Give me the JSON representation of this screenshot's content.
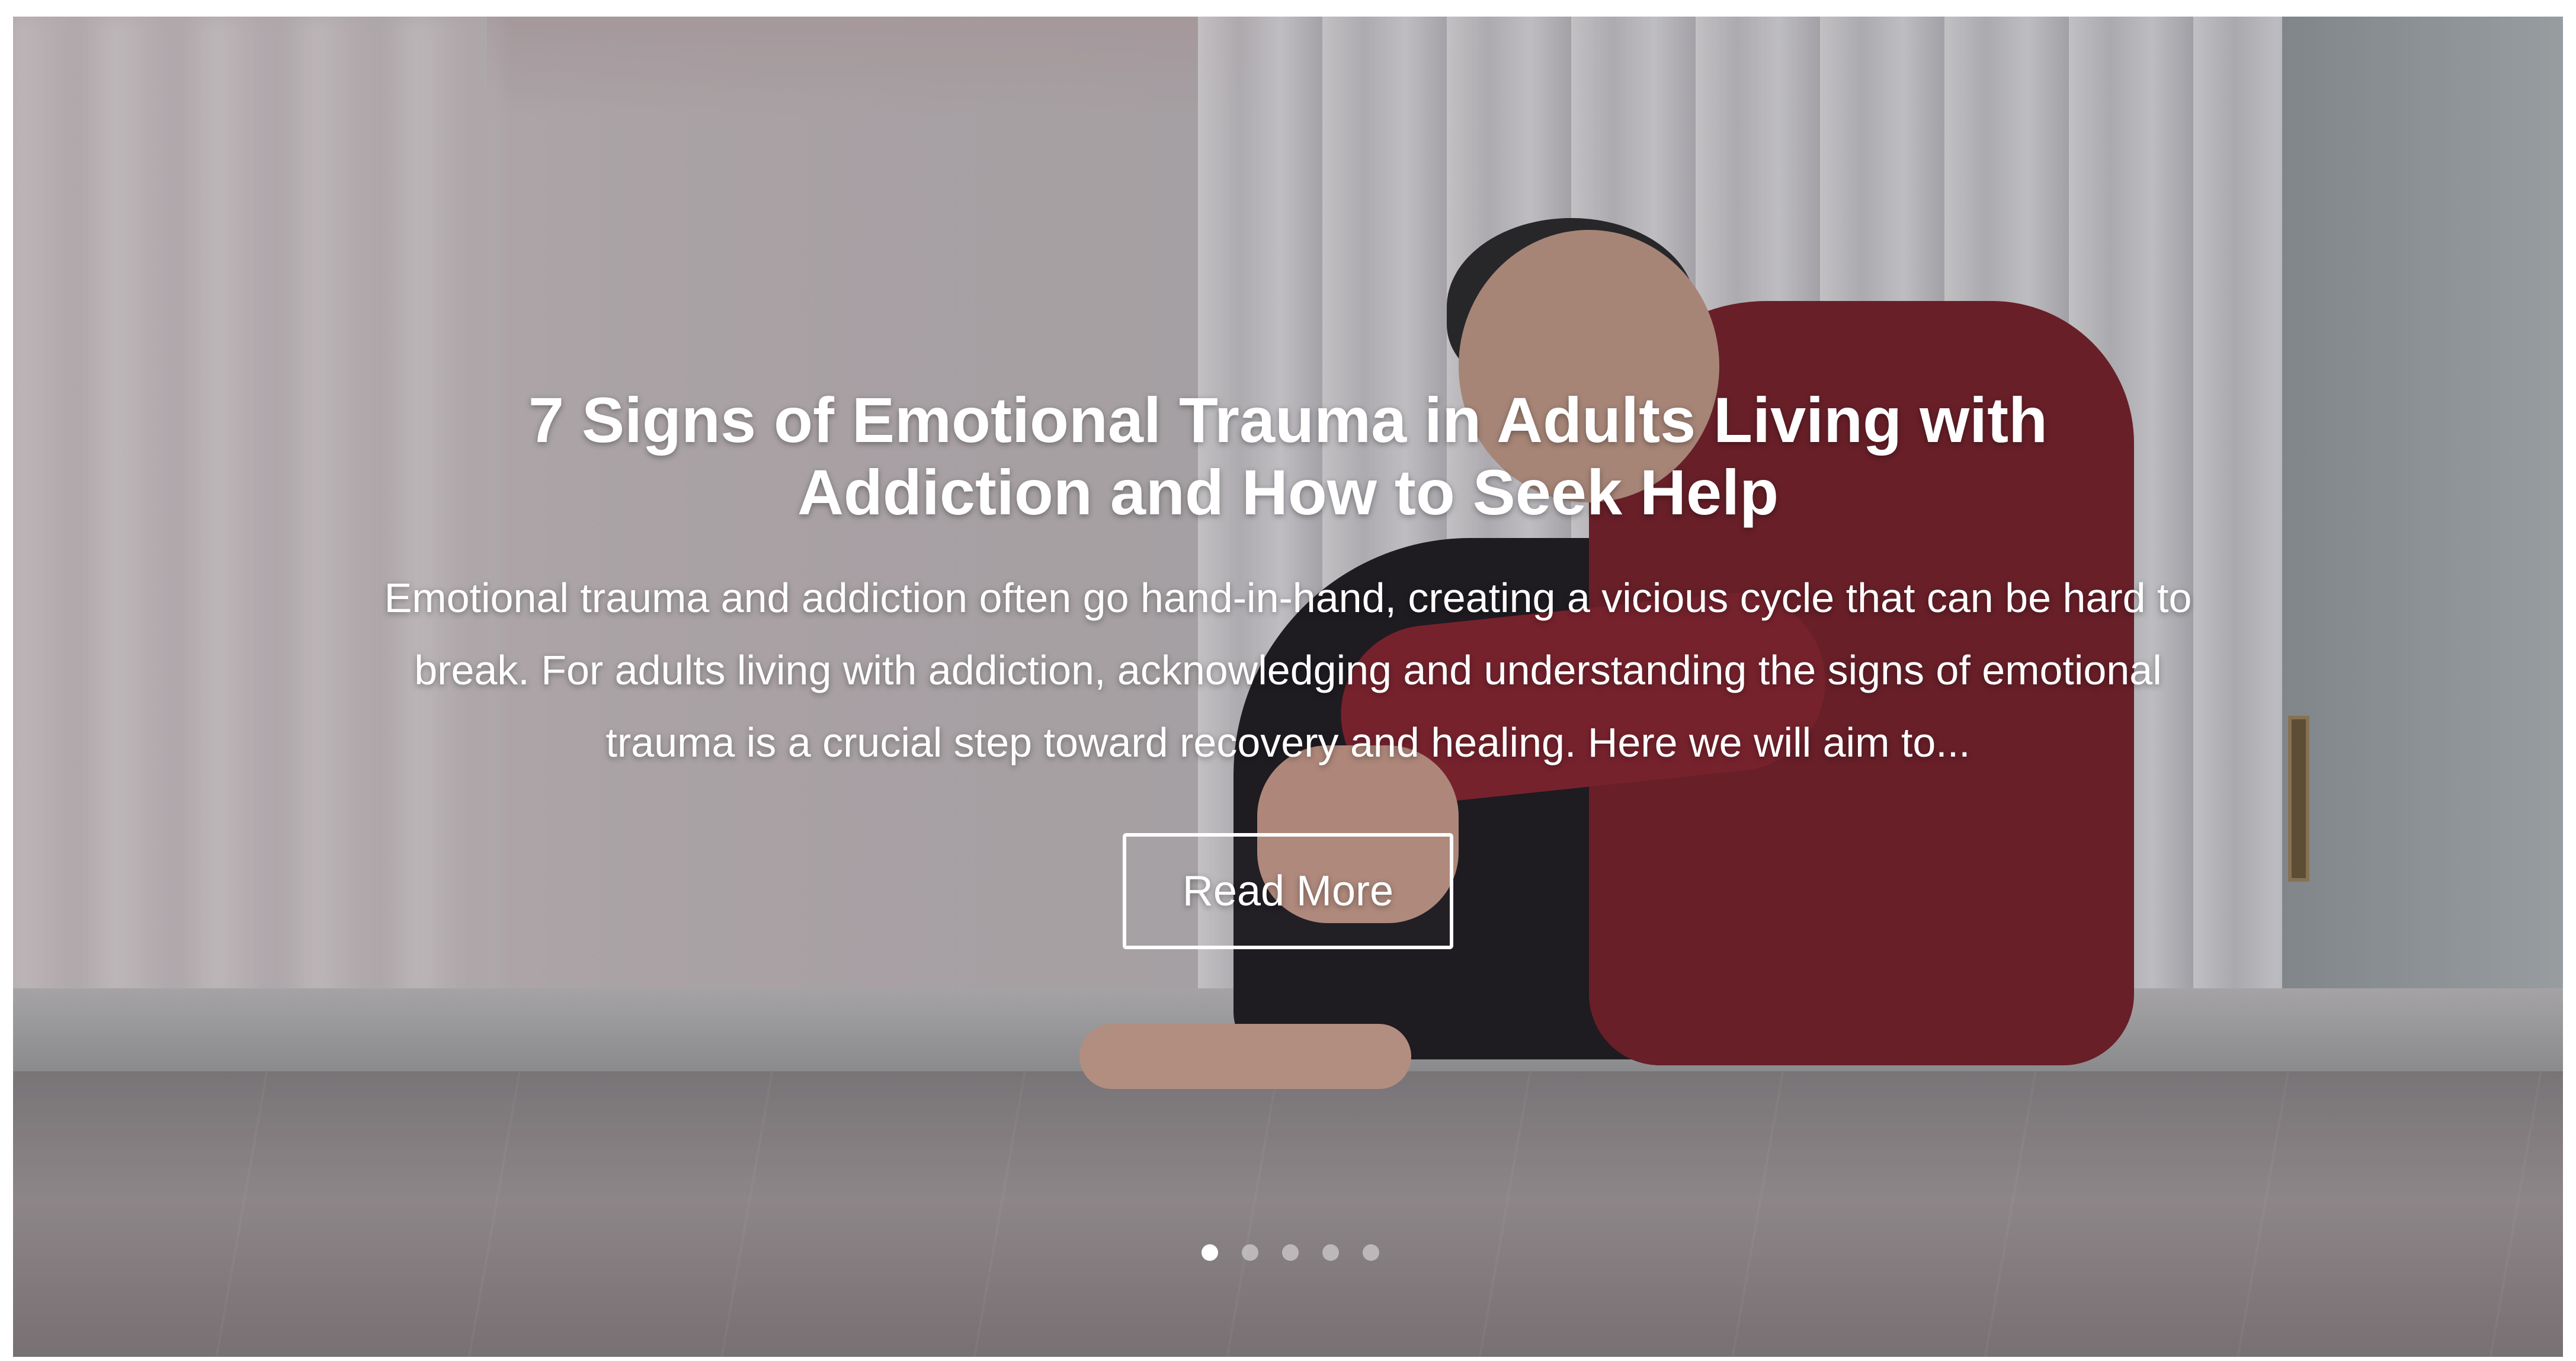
{
  "slide": {
    "title": "7 Signs of Emotional Trauma in Adults Living with Addiction and How to Seek Help",
    "excerpt": "Emotional trauma and addiction often go hand-in-hand, creating a vicious cycle that can be hard to break. For adults living with addiction, acknowledging and understanding the signs of emotional trauma is a crucial step toward recovery and healing. Here we will aim to...",
    "button_label": "Read More",
    "image_name": "person-sitting-against-wall-photo"
  },
  "pagination": {
    "total": 5,
    "active_index": 0
  },
  "colors": {
    "text": "#ffffff",
    "dot_active": "#ffffff",
    "dot_inactive": "rgba(255,255,255,0.45)"
  }
}
